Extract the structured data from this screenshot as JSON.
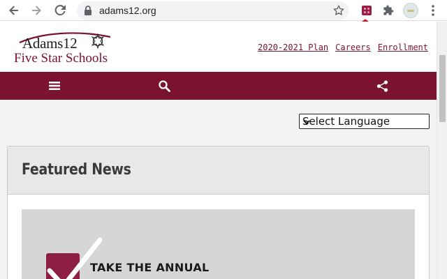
{
  "browser": {
    "url": "adams12.org",
    "icons": [
      "back-icon",
      "forward-icon",
      "reload-icon",
      "lock-icon",
      "bookmark-star-icon",
      "extension-icon",
      "puzzle-icon",
      "more-vert-icon"
    ]
  },
  "logo": {
    "line1": "Adams12",
    "line2": "Five Star Schools"
  },
  "header_links": [
    "2020-2021 Plan",
    "Careers",
    "Enrollment"
  ],
  "nav_icons": [
    "menu-icon",
    "search-icon",
    "share-icon"
  ],
  "language_select": {
    "value": "Select Language"
  },
  "featured": {
    "title": "Featured News",
    "image_text": "TAKE THE ANNUAL"
  },
  "colors": {
    "brand": "#7b1230",
    "annotation": "#e0161c"
  }
}
